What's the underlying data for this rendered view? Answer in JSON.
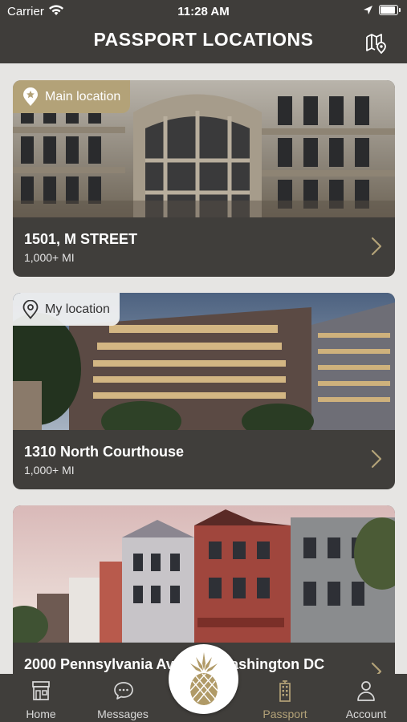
{
  "status_bar": {
    "carrier": "Carrier",
    "time": "11:28 AM"
  },
  "header": {
    "title": "PASSPORT LOCATIONS",
    "map_icon": "map-pin-icon"
  },
  "locations": [
    {
      "badge": "Main location",
      "badge_icon": "star-pin-icon",
      "name": "1501, M STREET",
      "distance": "1,000+ MI"
    },
    {
      "badge": "My location",
      "badge_icon": "location-pin-icon",
      "name": "1310 North Courthouse",
      "distance": "1,000+ MI"
    },
    {
      "name": "2000 Pennsylvania Ave NW, Washington DC"
    }
  ],
  "tabs": [
    {
      "label": "Home",
      "icon": "storefront-icon"
    },
    {
      "label": "Messages",
      "icon": "chat-bubble-icon"
    },
    {
      "label": "Passport",
      "icon": "passport-building-icon",
      "active": true
    },
    {
      "label": "Account",
      "icon": "person-icon"
    }
  ],
  "center_button": {
    "icon": "pineapple-icon"
  },
  "colors": {
    "header_bg": "#3f3d3a",
    "card_bg": "#403e3b",
    "accent_gold": "#b3a278",
    "page_bg": "#e6e5e3"
  }
}
